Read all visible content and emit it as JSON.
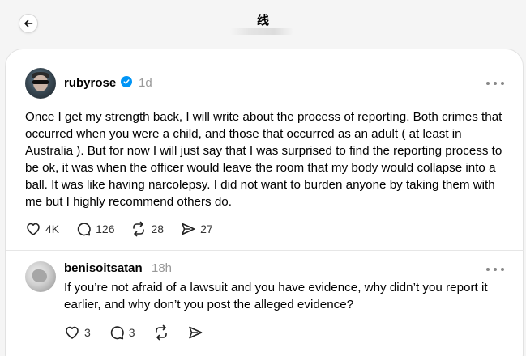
{
  "header": {
    "title": "线"
  },
  "post": {
    "username": "rubyrose",
    "time": "1d",
    "text": "Once I get my strength back, I will write about the process of reporting. Both crimes that occurred when you were a child, and those that occurred as an adult ( at least in Australia ). But for now I will just say that I was surprised to find the reporting process to be ok, it was when the officer would leave the room that my body would collapse into a ball. It was like having narcolepsy. I did not want to burden anyone by taking them with me but I highly recommend others do.",
    "likes": "4K",
    "comments": "126",
    "reposts": "28",
    "shares": "27"
  },
  "reply": {
    "username": "benisoitsatan",
    "time": "18h",
    "text": "If you’re not afraid of a lawsuit and you have evidence, why didn’t you report it earlier, and why don’t you post the alleged evidence?",
    "likes": "3",
    "comments": "3"
  },
  "icons": {
    "back": "arrow-left-icon",
    "verified": "verified-badge-icon",
    "more": "more-horizontal-icon",
    "like": "heart-icon",
    "comment": "comment-bubble-icon",
    "repost": "repost-icon",
    "share": "send-icon"
  },
  "colors": {
    "verified": "#0095f6",
    "timestamp": "#999999",
    "page_background": "#f5f5f5"
  }
}
